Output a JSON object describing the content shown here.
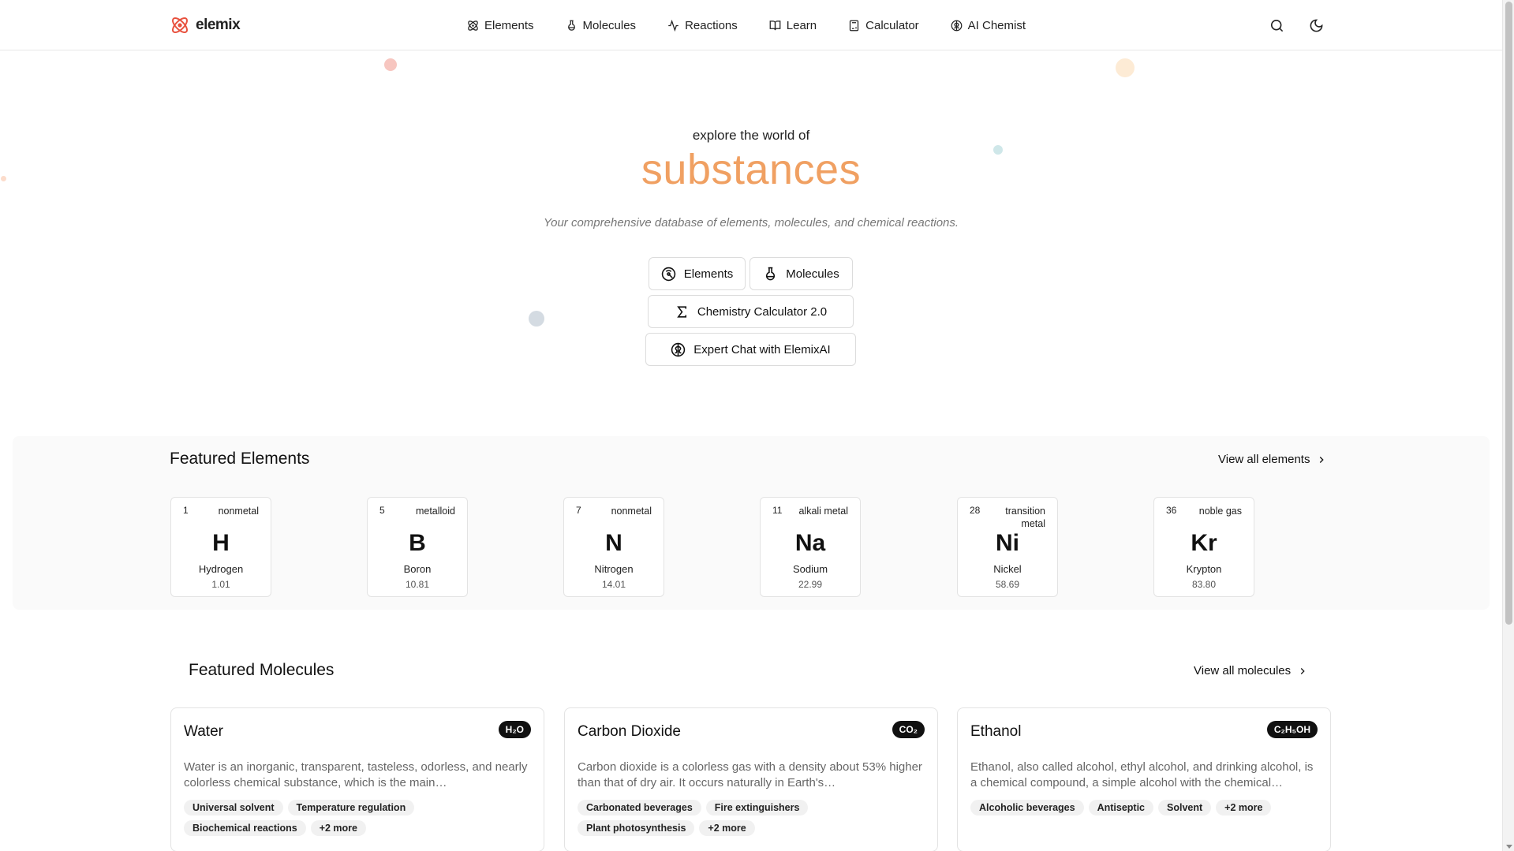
{
  "header": {
    "logo_text": "elemix",
    "nav": [
      {
        "label": "Elements",
        "icon": "atom-icon"
      },
      {
        "label": "Molecules",
        "icon": "flask-icon"
      },
      {
        "label": "Reactions",
        "icon": "activity-icon"
      },
      {
        "label": "Learn",
        "icon": "book-icon"
      },
      {
        "label": "Calculator",
        "icon": "calculator-icon"
      },
      {
        "label": "AI Chemist",
        "icon": "brain-icon"
      }
    ],
    "actions": [
      "search-icon",
      "moon-icon"
    ]
  },
  "hero": {
    "subtitle": "explore the world of",
    "title": "substances",
    "description": "Your comprehensive database of elements, molecules, and chemical reactions.",
    "buttons": {
      "elements": "Elements",
      "molecules": "Molecules",
      "calculator": "Chemistry Calculator 2.0",
      "chat": "Expert Chat with ElemixAI"
    }
  },
  "featured_elements": {
    "title": "Featured Elements",
    "view_all": "View all elements",
    "items": [
      {
        "number": "1",
        "category": "nonmetal",
        "symbol": "H",
        "name": "Hydrogen",
        "mass": "1.01"
      },
      {
        "number": "5",
        "category": "metalloid",
        "symbol": "B",
        "name": "Boron",
        "mass": "10.81"
      },
      {
        "number": "7",
        "category": "nonmetal",
        "symbol": "N",
        "name": "Nitrogen",
        "mass": "14.01"
      },
      {
        "number": "11",
        "category": "alkali metal",
        "symbol": "Na",
        "name": "Sodium",
        "mass": "22.99"
      },
      {
        "number": "28",
        "category": "transition metal",
        "symbol": "Ni",
        "name": "Nickel",
        "mass": "58.69"
      },
      {
        "number": "36",
        "category": "noble gas",
        "symbol": "Kr",
        "name": "Krypton",
        "mass": "83.80"
      }
    ]
  },
  "featured_molecules": {
    "title": "Featured Molecules",
    "view_all": "View all molecules",
    "items": [
      {
        "name": "Water",
        "formula": "H₂O",
        "description": "Water is an inorganic, transparent, tasteless, odorless, and nearly colorless chemical substance, which is the main…",
        "tags": [
          "Universal solvent",
          "Temperature regulation",
          "Biochemical reactions",
          "+2 more"
        ]
      },
      {
        "name": "Carbon Dioxide",
        "formula": "CO₂",
        "description": "Carbon dioxide is a colorless gas with a density about 53% higher than that of dry air. It occurs naturally in Earth's…",
        "tags": [
          "Carbonated beverages",
          "Fire extinguishers",
          "Plant photosynthesis",
          "+2 more"
        ]
      },
      {
        "name": "Ethanol",
        "formula": "C₂H₅OH",
        "description": "Ethanol, also called alcohol, ethyl alcohol, and drinking alcohol, is a chemical compound, a simple alcohol with the chemical…",
        "tags": [
          "Alcoholic beverages",
          "Antiseptic",
          "Solvent",
          "+2 more"
        ]
      }
    ]
  },
  "colors": {
    "accent": "#f0a062",
    "logo": "#e8523f",
    "text": "#111111",
    "muted": "#777777",
    "section_bg": "#fafafa"
  }
}
